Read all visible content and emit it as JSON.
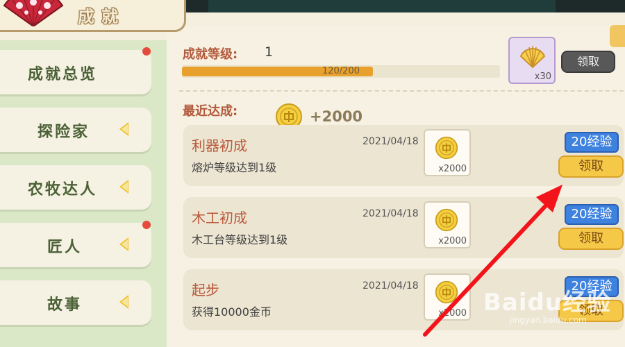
{
  "header": {
    "title": "成就"
  },
  "sidebar": {
    "items": [
      {
        "label": "成就总览",
        "dot": true
      },
      {
        "label": "探险家"
      },
      {
        "label": "农牧达人"
      },
      {
        "label": "匠人",
        "dot": true
      },
      {
        "label": "故事"
      }
    ]
  },
  "level": {
    "label": "成就等级:",
    "value": "1",
    "progress_text": "120/200",
    "progress_fraction": 0.6,
    "reward_count": "x30",
    "claim_label": "领取"
  },
  "recent": {
    "label": "最近达成:",
    "gain": "+2000"
  },
  "achievements": [
    {
      "title": "利器初成",
      "desc": "熔炉等级达到1级",
      "date": "2021/04/18",
      "reward_count": "x2000",
      "exp": "20经验",
      "claim": "领取"
    },
    {
      "title": "木工初成",
      "desc": "木工台等级达到1级",
      "date": "2021/04/18",
      "reward_count": "x2000",
      "exp": "20经验",
      "claim": "领取"
    },
    {
      "title": "起步",
      "desc": "获得10000金币",
      "date": "2021/04/18",
      "reward_count": "x2000",
      "exp": "20经验",
      "claim": "领取"
    }
  ],
  "watermark": {
    "brand": "Baidu经验",
    "sub": "jingyan.baidu.com"
  },
  "colors": {
    "accent": "#b35a3c",
    "progress": "#e8a12c",
    "exp_badge": "#3e82e0",
    "claim_button": "#f6c848",
    "claim_disabled": "#585858",
    "arrow": "#f2141a"
  },
  "icons": {
    "title": "fan-icon",
    "reward": "gold-coin-icon",
    "level_reward": "shell-icon",
    "side_arrow": "triangle-left-icon"
  }
}
